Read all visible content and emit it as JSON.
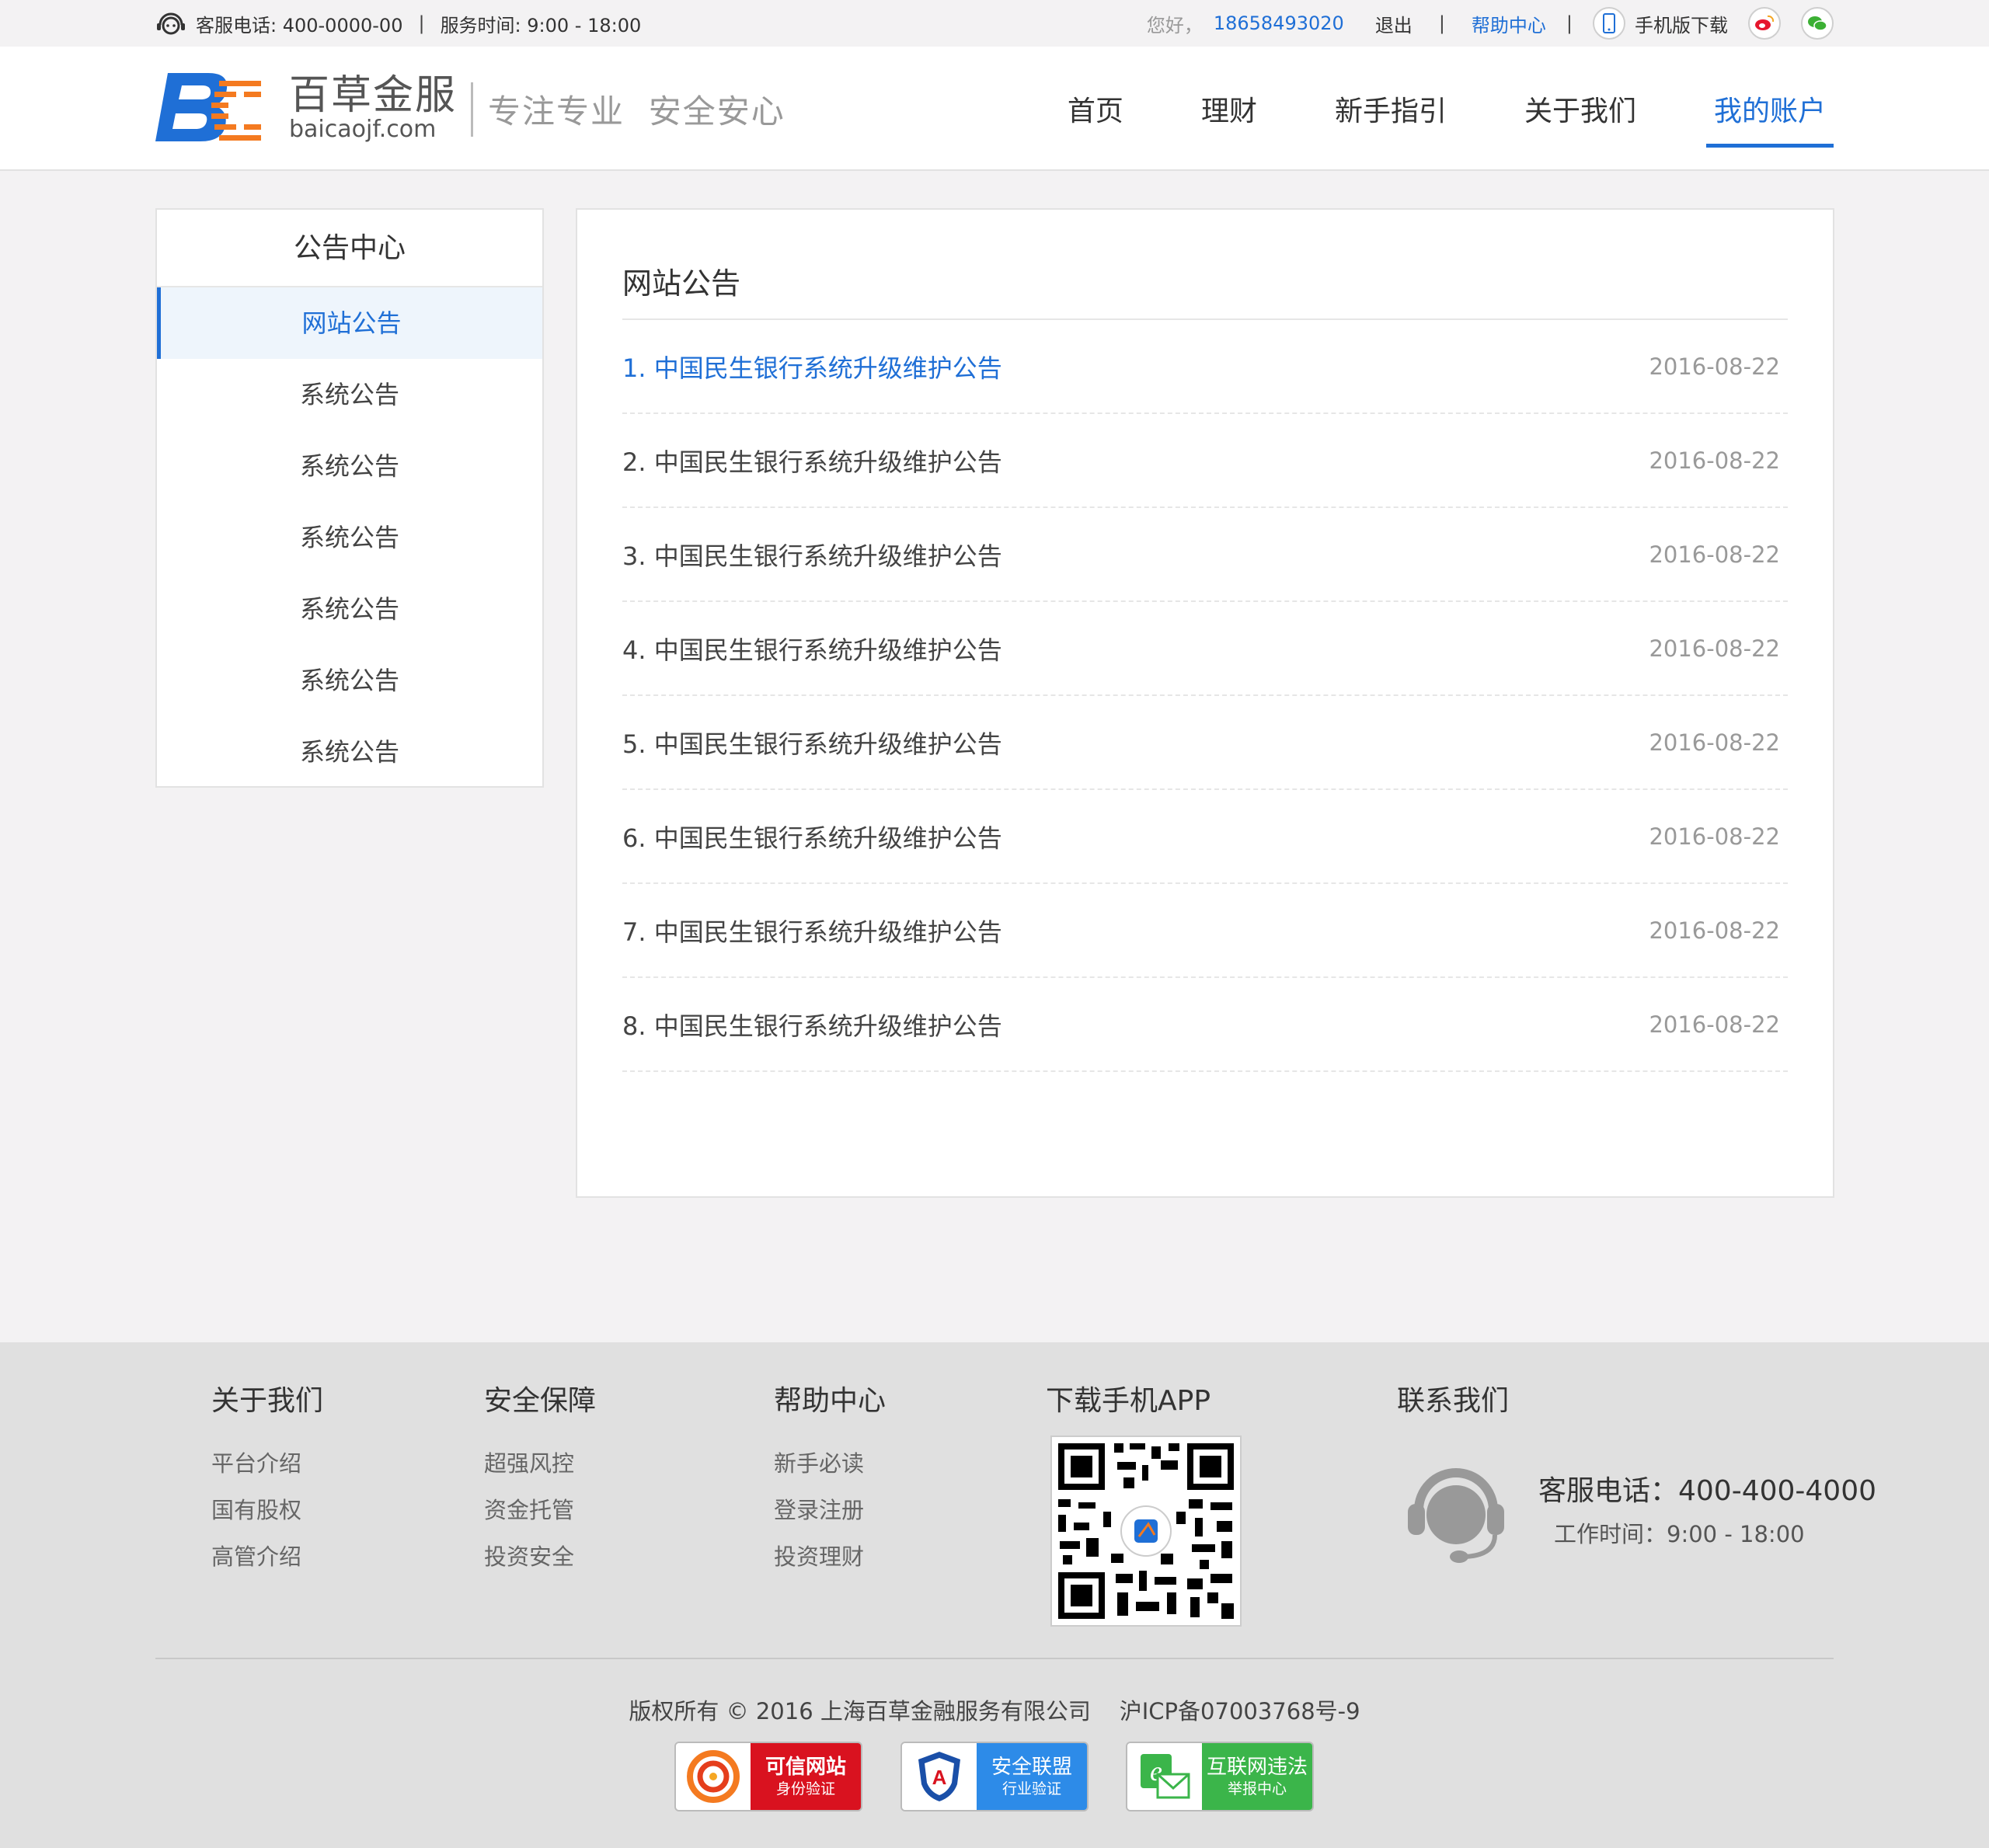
{
  "topbar": {
    "hotline": "客服电话: 400-0000-00",
    "divider": "|",
    "service_hours": "服务时间: 9:00 - 18:00",
    "greeting": "您好，",
    "user_phone": "18658493020",
    "logout": "退出",
    "help": "帮助中心",
    "app_download": "手机版下载"
  },
  "header": {
    "brand_cn": "百草金服",
    "brand_en": "baicaojf.com",
    "slogan": "专注专业  安全安心",
    "nav": [
      "首页",
      "理财",
      "新手指引",
      "关于我们",
      "我的账户"
    ],
    "active_nav": 4
  },
  "sidebar": {
    "title": "公告中心",
    "items": [
      "网站公告",
      "系统公告",
      "系统公告",
      "系统公告",
      "系统公告",
      "系统公告",
      "系统公告"
    ]
  },
  "main": {
    "title": "网站公告",
    "notices": [
      {
        "title": "1. 中国民生银行系统升级维护公告",
        "date": "2016-08-22"
      },
      {
        "title": "2. 中国民生银行系统升级维护公告",
        "date": "2016-08-22"
      },
      {
        "title": "3. 中国民生银行系统升级维护公告",
        "date": "2016-08-22"
      },
      {
        "title": "4. 中国民生银行系统升级维护公告",
        "date": "2016-08-22"
      },
      {
        "title": "5. 中国民生银行系统升级维护公告",
        "date": "2016-08-22"
      },
      {
        "title": "6. 中国民生银行系统升级维护公告",
        "date": "2016-08-22"
      },
      {
        "title": "7. 中国民生银行系统升级维护公告",
        "date": "2016-08-22"
      },
      {
        "title": "8. 中国民生银行系统升级维护公告",
        "date": "2016-08-22"
      }
    ]
  },
  "footer": {
    "about": {
      "title": "关于我们",
      "links": [
        "平台介绍",
        "国有股权",
        "高管介绍"
      ]
    },
    "security": {
      "title": "安全保障",
      "links": [
        "超强风控",
        "资金托管",
        "投资安全"
      ]
    },
    "help": {
      "title": "帮助中心",
      "links": [
        "新手必读",
        "登录注册",
        "投资理财"
      ]
    },
    "app": {
      "title": "下载手机APP"
    },
    "contact": {
      "title": "联系我们",
      "phone": "客服电话：400-400-4000",
      "hours": "工作时间：9:00 - 18:00"
    },
    "copyright": "版权所有 © 2016 上海百草金融服务有限公司    沪ICP备07003768号-9",
    "badges": [
      {
        "line1": "可信网站",
        "line2": "身份验证",
        "color": "#d9121f"
      },
      {
        "line1": "安全联盟",
        "line2": "行业验证",
        "color": "#2d8be8"
      },
      {
        "line1": "互联网违法",
        "line2": "举报中心",
        "color": "#3bb54a"
      }
    ]
  },
  "colors": {
    "accent": "#1f6fd6",
    "logo_orange": "#f47a20"
  }
}
